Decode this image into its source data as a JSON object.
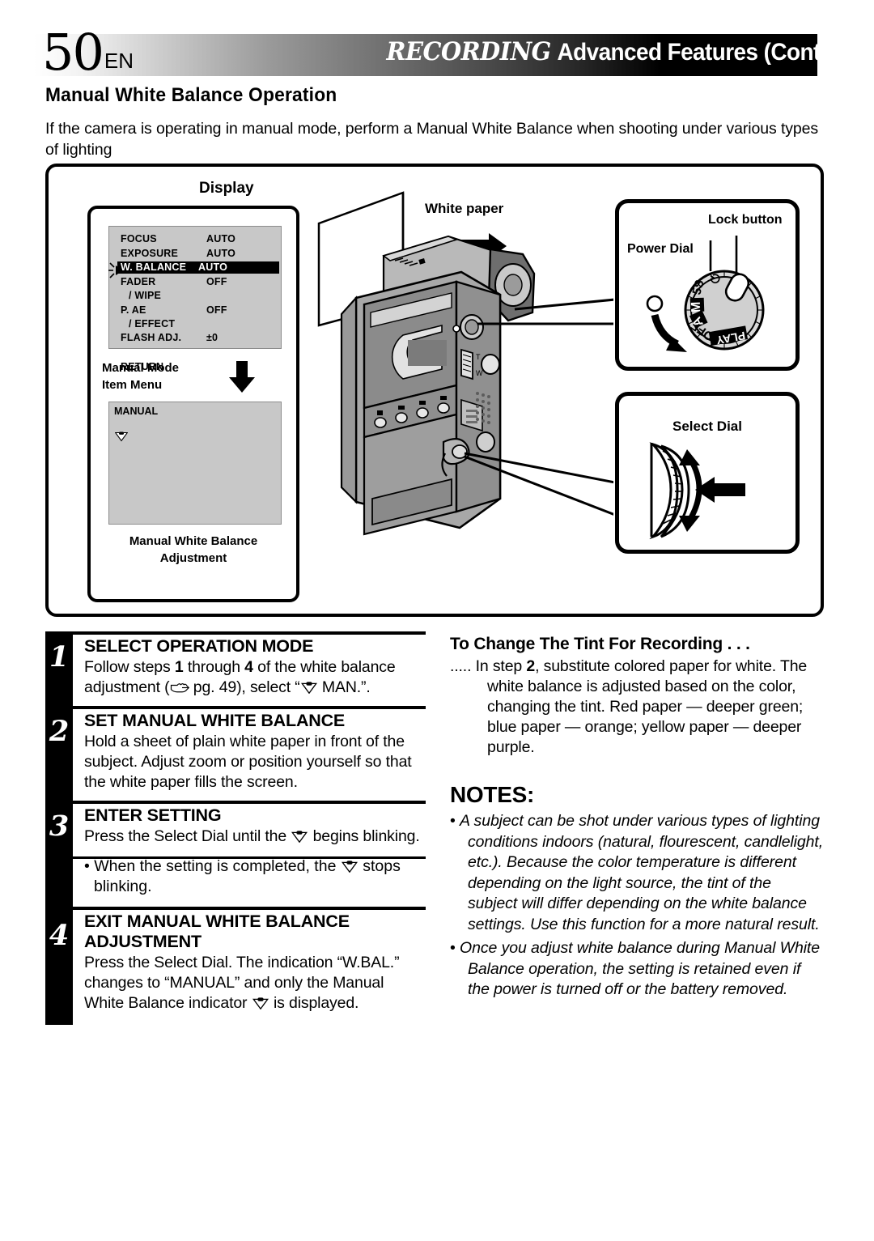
{
  "header": {
    "page_number": "50",
    "lang": "EN",
    "title_lead": "RECORDING",
    "title_rest": "Advanced Features (Cont.)"
  },
  "section": {
    "title": "Manual White Balance Operation",
    "intro": "If the camera is operating in manual mode, perform a Manual White Balance when shooting under various types of lighting"
  },
  "diagram": {
    "display_label": "Display",
    "white_paper_label": "White paper",
    "menu": {
      "rows": [
        {
          "name": "FOCUS",
          "value": "AUTO"
        },
        {
          "name": "EXPOSURE",
          "value": "AUTO"
        },
        {
          "name": "W. BALANCE",
          "value": "AUTO"
        },
        {
          "name": "FADER",
          "value": "OFF"
        },
        {
          "name": "/ WIPE",
          "value": ""
        },
        {
          "name": "P. AE",
          "value": "OFF"
        },
        {
          "name": "/ EFFECT",
          "value": ""
        },
        {
          "name": "FLASH ADJ.",
          "value": "±0"
        },
        {
          "name": "RETURN",
          "value": ""
        }
      ],
      "highlighted_row": "W. BALANCE"
    },
    "manual_mode_label_line1": "Manual Mode",
    "manual_mode_label_line2": "Item Menu",
    "manual_screen_title": "MANUAL",
    "adjustment_caption_line1": "Manual White Balance",
    "adjustment_caption_line2": "Adjustment",
    "power_dial": {
      "lock_button_label": "Lock button",
      "power_dial_label": "Power Dial",
      "positions": [
        "⏻",
        "5S",
        "M",
        "A",
        "OFF",
        "PLAY"
      ]
    },
    "select_dial": {
      "label": "Select Dial"
    }
  },
  "steps": [
    {
      "number": "1",
      "heading": "SELECT OPERATION MODE",
      "body_pre": "Follow steps ",
      "body_b1": "1",
      "body_mid": " through ",
      "body_b2": "4",
      "body_post": " of the white balance adjustment (",
      "body_pg": " pg. 49), select “",
      "body_end": " MAN.”."
    },
    {
      "number": "2",
      "heading": "SET MANUAL WHITE BALANCE",
      "body": "Hold a sheet of plain white paper in front of the subject. Adjust zoom or position yourself so that the white paper fills the screen."
    },
    {
      "number": "3",
      "heading": "ENTER SETTING",
      "body_pre": "Press the Select Dial until the ",
      "body_post": " begins blinking."
    },
    {
      "number": "4",
      "heading_line1": "EXIT MANUAL WHITE BALANCE",
      "heading_line2": "ADJUSTMENT",
      "body_pre": "Press the Select Dial. The indication “W.BAL.” changes to “MANUAL” and only the Manual White Balance indicator ",
      "body_post": " is displayed."
    }
  ],
  "step3_bullet": {
    "pre": "• When the setting is completed, the ",
    "post": " stops blinking."
  },
  "tint": {
    "heading": "To Change The Tint For Recording . . .",
    "lead": "..... In step ",
    "bold": "2",
    "body": ", substitute colored paper for white. The white balance is adjusted based on the color, changing the tint. Red paper — deeper green; blue paper — orange; yellow paper — deeper purple."
  },
  "notes": {
    "heading": "NOTES:",
    "items": [
      "A subject can be shot under various types of lighting conditions indoors (natural, flourescent, candlelight, etc.). Because the color temperature is different depending on the light source, the tint of the subject will differ depending on the white balance settings. Use this function for a more natural result.",
      "Once you adjust white balance during Manual White Balance operation, the setting is retained even if the power is turned off or the battery removed."
    ]
  }
}
